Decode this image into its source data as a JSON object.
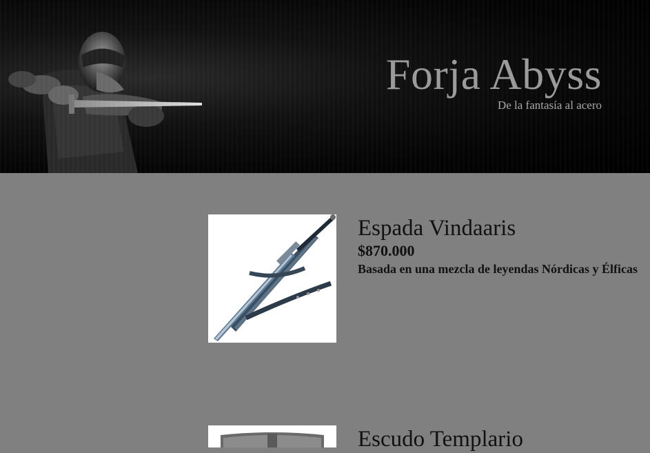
{
  "header": {
    "title": "Forja Abyss",
    "subtitle": "De la fantasía al acero",
    "hero_image": "armored-knight-with-sword"
  },
  "products": [
    {
      "name": "Espada Vindaaris",
      "price": "$870.000",
      "description": "Basada en una mezcla de leyendas Nórdicas y Élficas",
      "image": "sword-with-scabbard"
    },
    {
      "name": "Escudo Templario",
      "image": "templar-shield"
    }
  ],
  "colors": {
    "header_bg": "#000000",
    "page_bg": "#808080",
    "title": "#9a9a9a",
    "text": "#111111",
    "card_image_bg": "#ffffff"
  }
}
